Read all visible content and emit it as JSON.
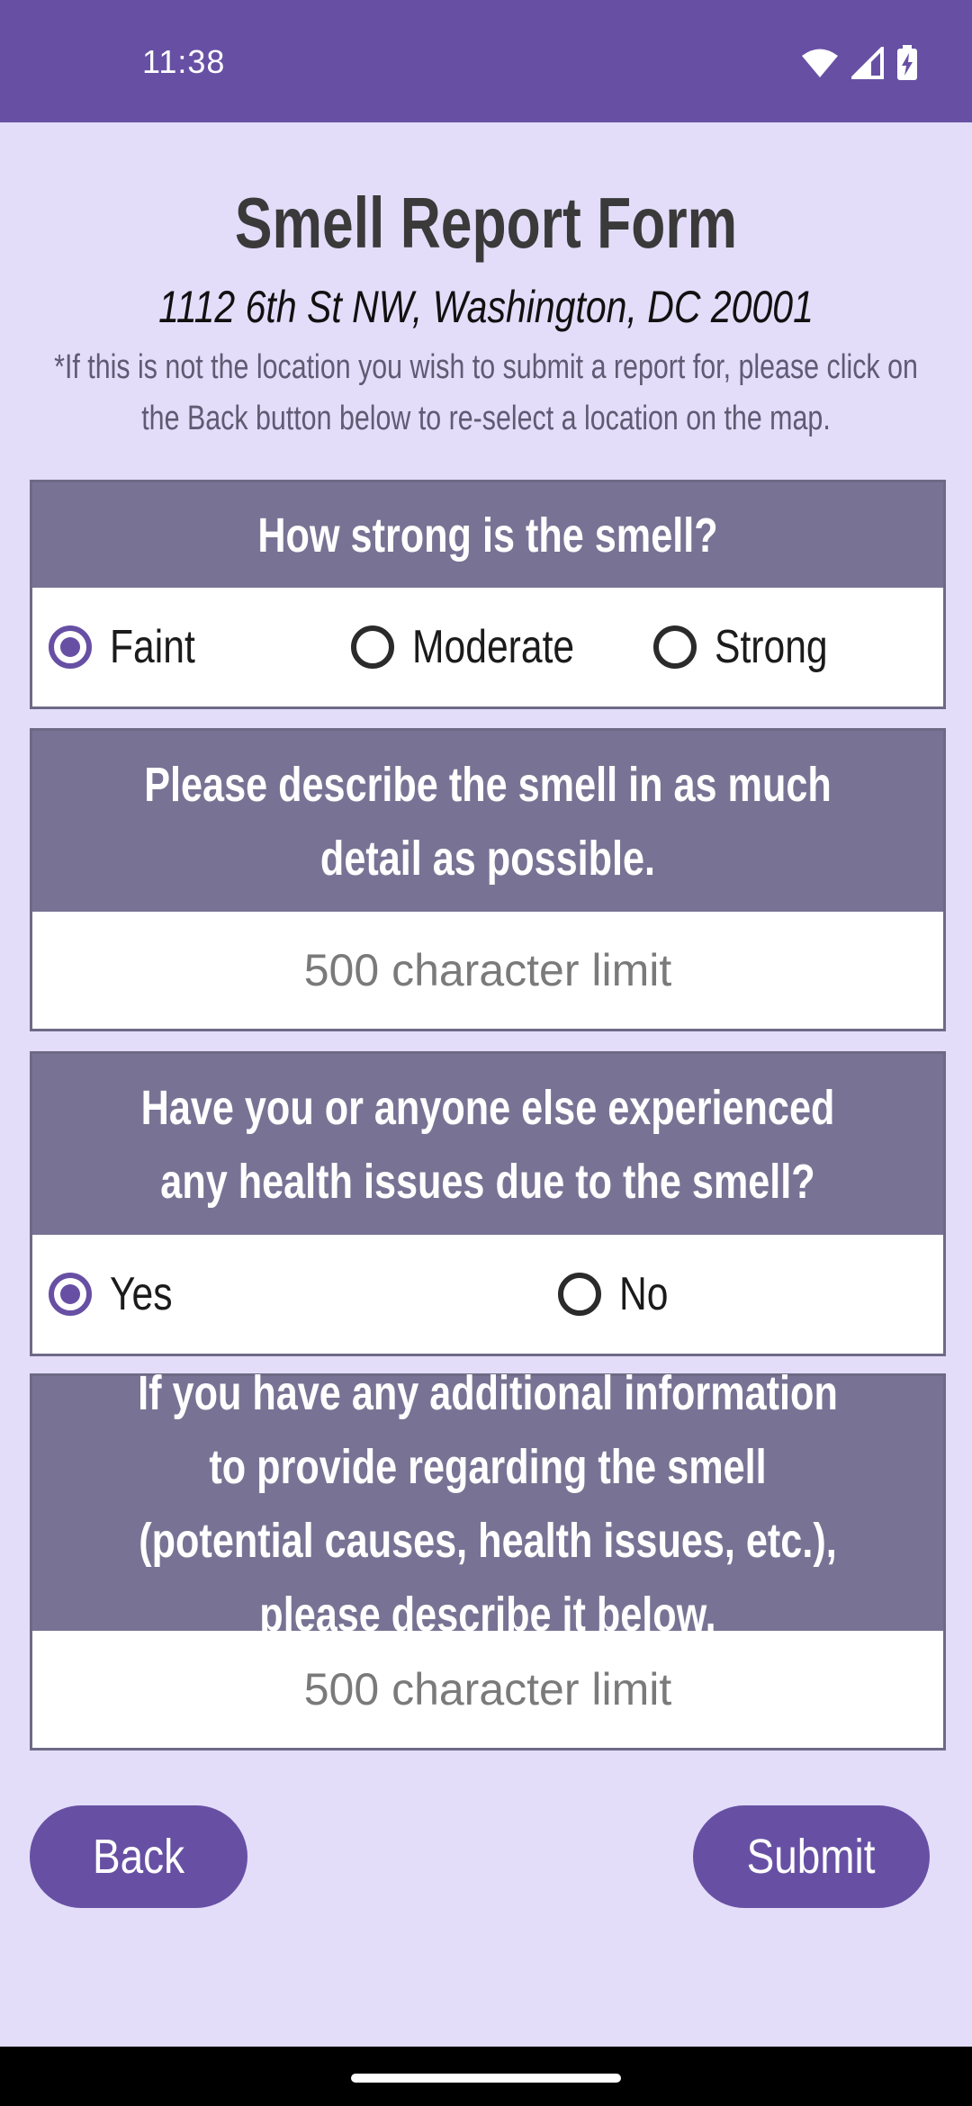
{
  "status": {
    "time": "11:38",
    "icons": [
      "wifi-icon",
      "signal-icon",
      "battery-charging-icon"
    ]
  },
  "form": {
    "title": "Smell Report Form",
    "address": "1112 6th St NW, Washington, DC 20001",
    "note": "*If this is not the location you wish to submit a report for, please click on the Back button below to re-select a location on the map."
  },
  "strength": {
    "question": "How strong is the smell?",
    "options": [
      "Faint",
      "Moderate",
      "Strong"
    ],
    "selected": "Faint"
  },
  "description": {
    "question": "Please describe the smell in as much detail as possible.",
    "placeholder": "500 character limit",
    "value": ""
  },
  "health": {
    "question": "Have you or anyone else experienced any health issues due to the smell?",
    "options": [
      "Yes",
      "No"
    ],
    "selected": "Yes"
  },
  "additional": {
    "question": "If you have any additional information to provide regarding the smell (potential causes, health issues, etc.), please describe it below.",
    "placeholder": "500 character limit",
    "value": ""
  },
  "buttons": {
    "back": "Back",
    "submit": "Submit"
  },
  "colors": {
    "accent": "#6750a4",
    "background": "#e3ddfa",
    "card_header": "#787394"
  }
}
